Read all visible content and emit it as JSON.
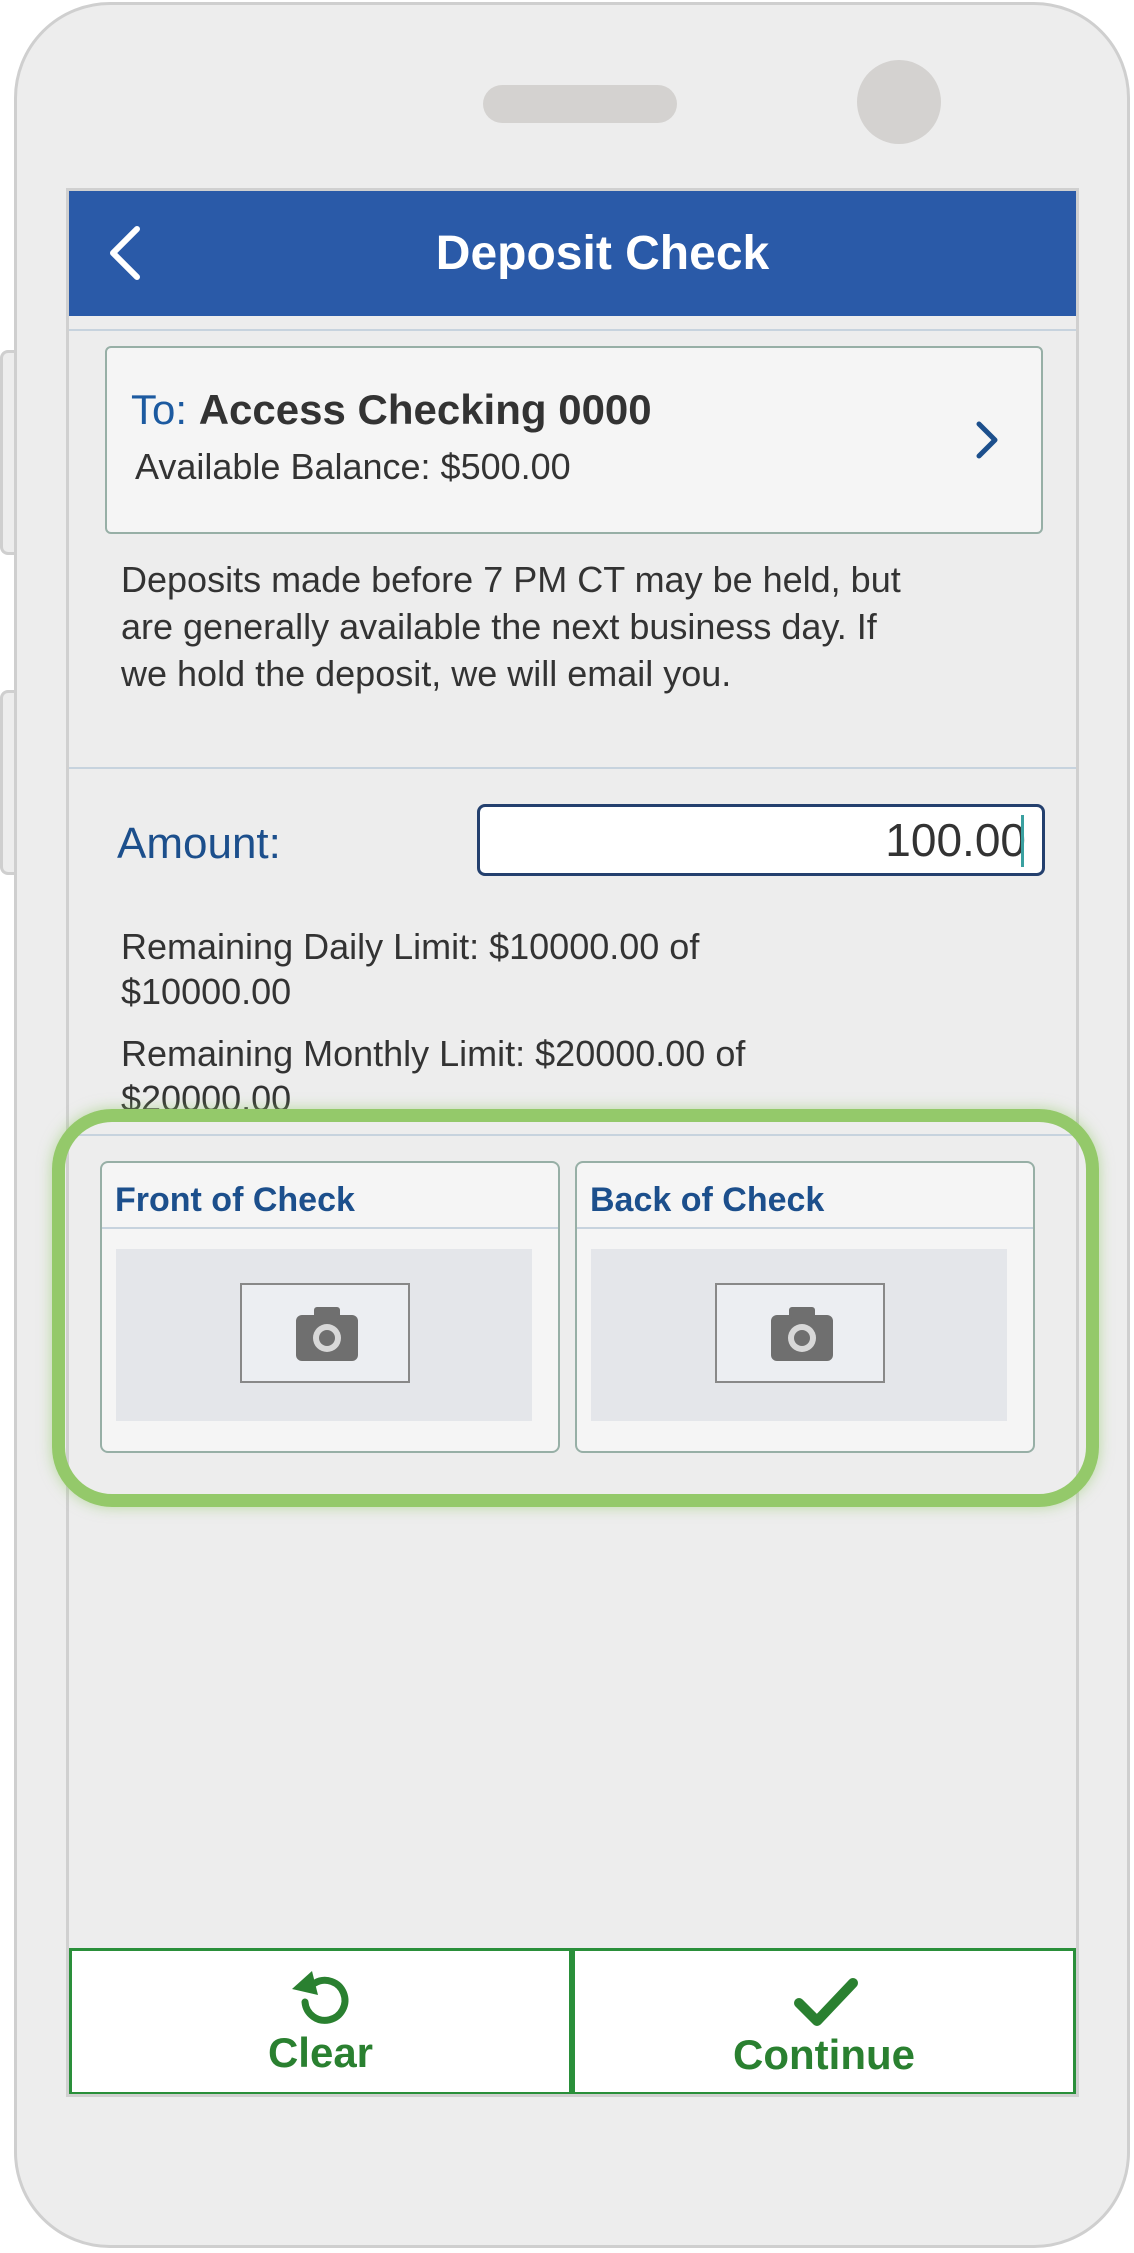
{
  "header": {
    "title": "Deposit Check"
  },
  "account": {
    "to_label": "To:",
    "name": "Access Checking 0000",
    "balance_text": "Available Balance: $500.00"
  },
  "notice": "Deposits made before 7 PM CT may be held, but are generally available the next business day. If we hold the deposit, we will email you.",
  "amount": {
    "label": "Amount:",
    "value": "100.00"
  },
  "limits": {
    "daily": "Remaining Daily Limit: $10000.00 of $10000.00",
    "monthly": "Remaining Monthly Limit: $20000.00 of $20000.00"
  },
  "check_images": [
    {
      "label": "Front of Check",
      "icon": "camera-icon"
    },
    {
      "label": "Back of Check",
      "icon": "camera-icon"
    }
  ],
  "footer": {
    "clear_label": "Clear",
    "continue_label": "Continue"
  },
  "colors": {
    "header_bg": "#2a5aa8",
    "link_blue": "#1c4f8c",
    "action_green": "#2a8030",
    "highlight_green": "#94c96a"
  }
}
